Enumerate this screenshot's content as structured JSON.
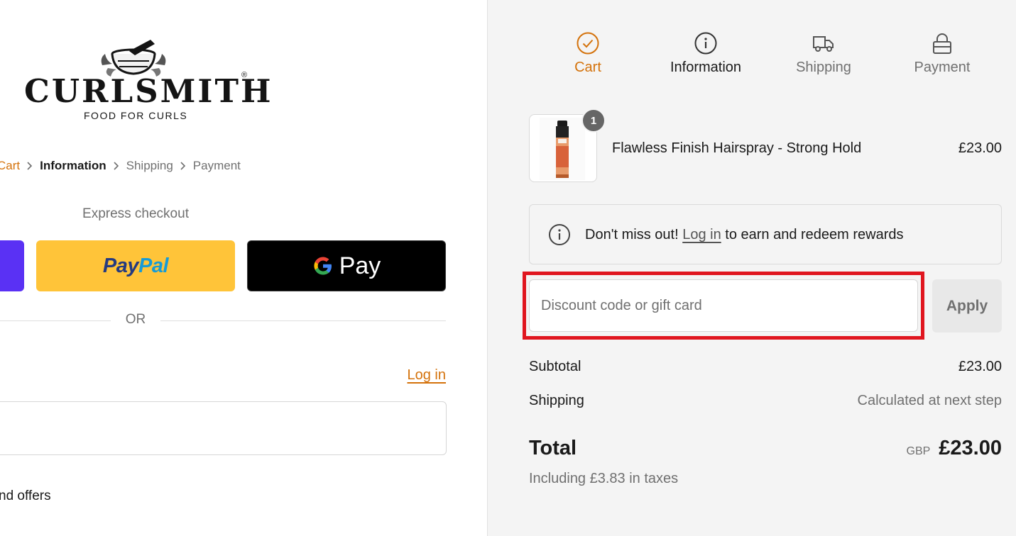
{
  "brand": {
    "name": "CURLSMITH",
    "registered_mark": "®",
    "tagline": "FOOD FOR CURLS"
  },
  "breadcrumb": {
    "items": [
      {
        "label": "Cart",
        "state": "link"
      },
      {
        "label": "Information",
        "state": "current"
      },
      {
        "label": "Shipping",
        "state": "upcoming"
      },
      {
        "label": "Payment",
        "state": "upcoming"
      }
    ]
  },
  "express": {
    "title": "Express checkout",
    "paypal_label_1": "Pay",
    "paypal_label_2": "Pal",
    "gpay_label": "Pay",
    "divider_text": "OR"
  },
  "contact": {
    "login_link": "Log in",
    "offers_text": "nd offers"
  },
  "steps": [
    {
      "label": "Cart",
      "icon": "check-circle-icon",
      "state": "active"
    },
    {
      "label": "Information",
      "icon": "info-circle-icon",
      "state": "current"
    },
    {
      "label": "Shipping",
      "icon": "truck-icon",
      "state": "upcoming"
    },
    {
      "label": "Payment",
      "icon": "lock-icon",
      "state": "upcoming"
    }
  ],
  "order": {
    "items": [
      {
        "name": "Flawless Finish Hairspray - Strong Hold",
        "price": "£23.00",
        "quantity": "1"
      }
    ]
  },
  "rewards": {
    "prefix": "Don't miss out!",
    "link": "Log in",
    "suffix": "to earn and redeem rewards"
  },
  "discount": {
    "placeholder": "Discount code or gift card",
    "value": "",
    "apply_label": "Apply"
  },
  "summary": {
    "subtotal_label": "Subtotal",
    "subtotal_value": "£23.00",
    "shipping_label": "Shipping",
    "shipping_value": "Calculated at next step",
    "total_label": "Total",
    "currency": "GBP",
    "total_value": "£23.00",
    "taxes_note": "Including £3.83 in taxes"
  },
  "colors": {
    "accent": "#d4720b",
    "highlight": "#e0161f",
    "paypal_yellow": "#ffc439",
    "shop_purple": "#5a31f4",
    "summary_bg": "#f4f4f4"
  }
}
